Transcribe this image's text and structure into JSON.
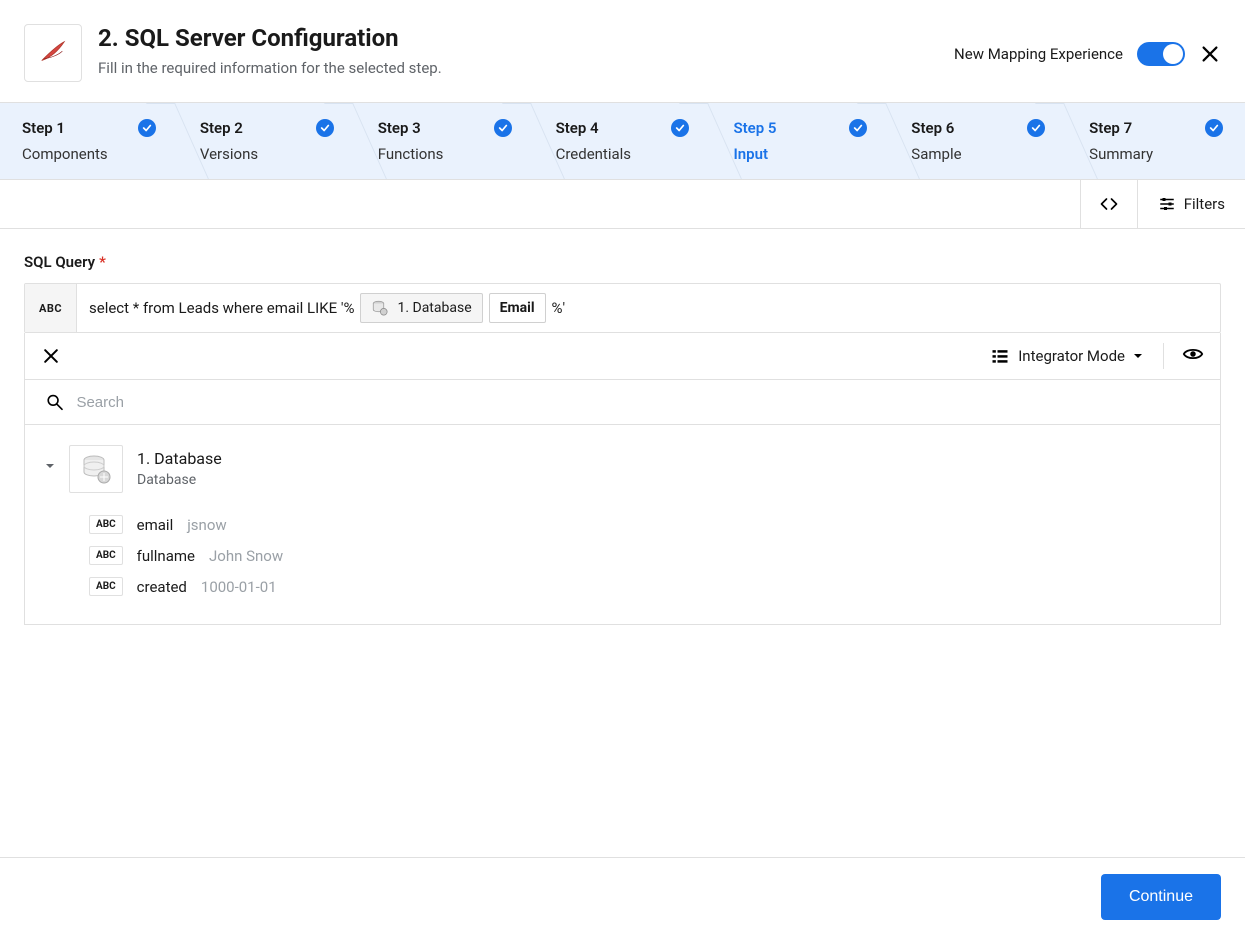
{
  "header": {
    "title": "2. SQL Server Configuration",
    "subtitle": "Fill in the required information for the selected step.",
    "toggle_label": "New Mapping Experience"
  },
  "steps": [
    {
      "num": "Step 1",
      "name": "Components",
      "active": false,
      "checked": true
    },
    {
      "num": "Step 2",
      "name": "Versions",
      "active": false,
      "checked": true
    },
    {
      "num": "Step 3",
      "name": "Functions",
      "active": false,
      "checked": true
    },
    {
      "num": "Step 4",
      "name": "Credentials",
      "active": false,
      "checked": true
    },
    {
      "num": "Step 5",
      "name": "Input",
      "active": true,
      "checked": true
    },
    {
      "num": "Step 6",
      "name": "Sample",
      "active": false,
      "checked": true
    },
    {
      "num": "Step 7",
      "name": "Summary",
      "active": false,
      "checked": true
    }
  ],
  "toolbar": {
    "filters_label": "Filters"
  },
  "field": {
    "label": "SQL Query",
    "required_mark": "*",
    "abc": "ABC",
    "prefix_text": "select * from Leads where email LIKE '%",
    "db_pill": "1. Database",
    "email_pill": "Email",
    "suffix_text": "%'"
  },
  "mapper": {
    "mode_label": "Integrator Mode",
    "search_placeholder": "Search",
    "node_title": "1. Database",
    "node_subtitle": "Database",
    "fields": [
      {
        "name": "email",
        "value": "jsnow"
      },
      {
        "name": "fullname",
        "value": "John Snow"
      },
      {
        "name": "created",
        "value": "1000-01-01"
      }
    ],
    "abc_badge": "ABC"
  },
  "footer": {
    "continue_label": "Continue"
  }
}
